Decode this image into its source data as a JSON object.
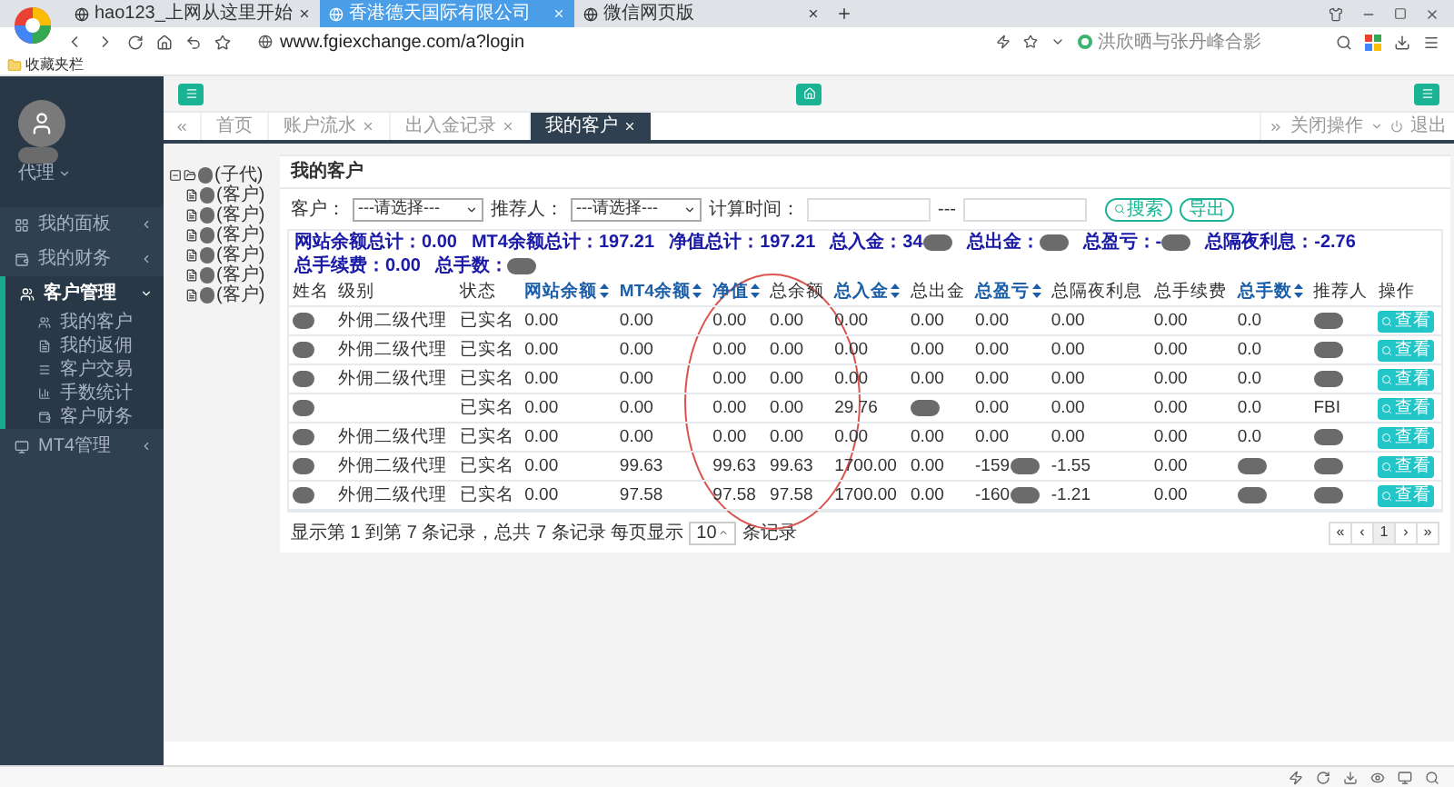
{
  "browser": {
    "tabs": [
      {
        "title": "hao123_上网从这里开始",
        "selected": false
      },
      {
        "title": "香港德天国际有限公司",
        "selected": true
      },
      {
        "title": "微信网页版",
        "selected": false
      }
    ],
    "address": "www.fgiexchange.com/a?login",
    "search": "洪欣晒与张丹峰合影",
    "bookmarks": [
      "收藏夹栏"
    ]
  },
  "user": {
    "role": "代理"
  },
  "sidebar": {
    "items": [
      {
        "label": "我的面板",
        "expanded": false
      },
      {
        "label": "我的财务",
        "expanded": false
      },
      {
        "label": "客户管理",
        "expanded": true,
        "children": [
          {
            "label": "我的客户"
          },
          {
            "label": "我的返佣"
          },
          {
            "label": "客户交易"
          },
          {
            "label": "手数统计"
          },
          {
            "label": "客户财务"
          }
        ]
      },
      {
        "label": "MT4管理",
        "expanded": false
      }
    ]
  },
  "page_tabs": [
    {
      "label": "首页",
      "closable": false,
      "selected": false
    },
    {
      "label": "账户流水",
      "closable": true,
      "selected": false
    },
    {
      "label": "出入金记录",
      "closable": true,
      "selected": false
    },
    {
      "label": "我的客户",
      "closable": true,
      "selected": true
    }
  ],
  "tab_actions": {
    "close": "关闭操作",
    "logout": "退出"
  },
  "tree": {
    "label": "(子代)",
    "expanded": true,
    "children": [
      {
        "label": "(客户)"
      },
      {
        "label": "(客户)"
      },
      {
        "label": "(客户)"
      },
      {
        "label": "(客户)"
      },
      {
        "label": "(客户)"
      },
      {
        "label": "(客户)"
      }
    ]
  },
  "panel": {
    "title": "我的客户",
    "filters": [
      {
        "label": "客户：",
        "kind": "select",
        "value": "---请选择---"
      },
      {
        "label": "推荐人：",
        "kind": "select",
        "value": "---请选择---"
      },
      {
        "label": "计算时间：",
        "kind": "date"
      }
    ],
    "range_sep": "---",
    "buttons": [
      "搜索",
      "导出"
    ],
    "summary": [
      {
        "label": "网站余额总计：",
        "value": "0.00",
        "redacted": false
      },
      {
        "label": "MT4余额总计：",
        "value": "197.21",
        "redacted": false
      },
      {
        "label": "净值总计：",
        "value": "197.21",
        "redacted": false
      },
      {
        "label": "总入金：",
        "value": "34",
        "redacted": true
      },
      {
        "label": "总出金：",
        "redacted": true
      },
      {
        "label": "总盈亏：",
        "value": "-",
        "redacted": true
      },
      {
        "label": "总隔夜利息：",
        "value": "-2.76",
        "redacted": false
      },
      {
        "label": "总手续费：",
        "value": "0.00",
        "redacted": false
      },
      {
        "label": "总手数：",
        "redacted": true
      }
    ],
    "columns": [
      {
        "label": "姓名",
        "sortable": false
      },
      {
        "label": "级别",
        "sortable": false
      },
      {
        "label": "状态",
        "sortable": false
      },
      {
        "label": "网站余额",
        "sortable": true
      },
      {
        "label": "MT4余额",
        "sortable": true
      },
      {
        "label": "净值",
        "sortable": true
      },
      {
        "label": "总余额",
        "sortable": false
      },
      {
        "label": "总入金",
        "sortable": true
      },
      {
        "label": "总出金",
        "sortable": false
      },
      {
        "label": "总盈亏",
        "sortable": true
      },
      {
        "label": "总隔夜利息",
        "sortable": false
      },
      {
        "label": "总手续费",
        "sortable": false
      },
      {
        "label": "总手数",
        "sortable": true
      },
      {
        "label": "推荐人",
        "sortable": false
      },
      {
        "label": "操作",
        "sortable": false
      }
    ],
    "rows": [
      {
        "cells": [
          {
            "redacted": true
          },
          "外佣二级代理",
          "已实名",
          "0.00",
          "0.00",
          "0.00",
          "0.00",
          "0.00",
          "0.00",
          "0.00",
          "0.00",
          "0.00",
          "0.0",
          {
            "redacted": true
          }
        ],
        "action": "查看"
      },
      {
        "cells": [
          {
            "redacted": true
          },
          "外佣二级代理",
          "已实名",
          "0.00",
          "0.00",
          "0.00",
          "0.00",
          "0.00",
          "0.00",
          "0.00",
          "0.00",
          "0.00",
          "0.0",
          {
            "redacted": true
          }
        ],
        "action": "查看"
      },
      {
        "cells": [
          {
            "redacted": true
          },
          "外佣二级代理",
          "已实名",
          "0.00",
          "0.00",
          "0.00",
          "0.00",
          "0.00",
          "0.00",
          "0.00",
          "0.00",
          "0.00",
          "0.0",
          {
            "redacted": true
          }
        ],
        "action": "查看"
      },
      {
        "cells": [
          {
            "redacted": true
          },
          "",
          "已实名",
          "0.00",
          "0.00",
          "0.00",
          "0.00",
          "29.76",
          {
            "redacted": true
          },
          "0.00",
          "0.00",
          "0.00",
          "0.0",
          "FBI"
        ],
        "action": "查看"
      },
      {
        "cells": [
          {
            "redacted": true
          },
          "外佣二级代理",
          "已实名",
          "0.00",
          "0.00",
          "0.00",
          "0.00",
          "0.00",
          "0.00",
          "0.00",
          "0.00",
          "0.00",
          "0.0",
          {
            "redacted": true
          }
        ],
        "action": "查看"
      },
      {
        "cells": [
          {
            "redacted": true
          },
          "外佣二级代理",
          "已实名",
          "0.00",
          "99.63",
          "99.63",
          "99.63",
          "1700.00",
          "0.00",
          {
            "redacted": true,
            "text": "-159"
          },
          "-1.55",
          "0.00",
          {
            "redacted": true
          },
          {
            "redacted": true
          }
        ],
        "action": "查看"
      },
      {
        "cells": [
          {
            "redacted": true
          },
          "外佣二级代理",
          "已实名",
          "0.00",
          "97.58",
          "97.58",
          "97.58",
          "1700.00",
          "0.00",
          {
            "redacted": true,
            "text": "-160"
          },
          "-1.21",
          "0.00",
          {
            "redacted": true
          },
          {
            "redacted": true
          }
        ],
        "action": "查看"
      }
    ],
    "footer": {
      "before": "显示第 1 到第 7 条记录，总共 7 条记录 每页显示",
      "page_size": "10",
      "after": "条记录"
    },
    "pagination": [
      {
        "label": "«",
        "selected": false
      },
      {
        "label": "‹",
        "selected": false
      },
      {
        "label": "1",
        "selected": true
      },
      {
        "label": "›",
        "selected": false
      },
      {
        "label": "»",
        "selected": false
      }
    ]
  },
  "annotation": {
    "kind": "ellipse",
    "color": "#d9534f"
  }
}
